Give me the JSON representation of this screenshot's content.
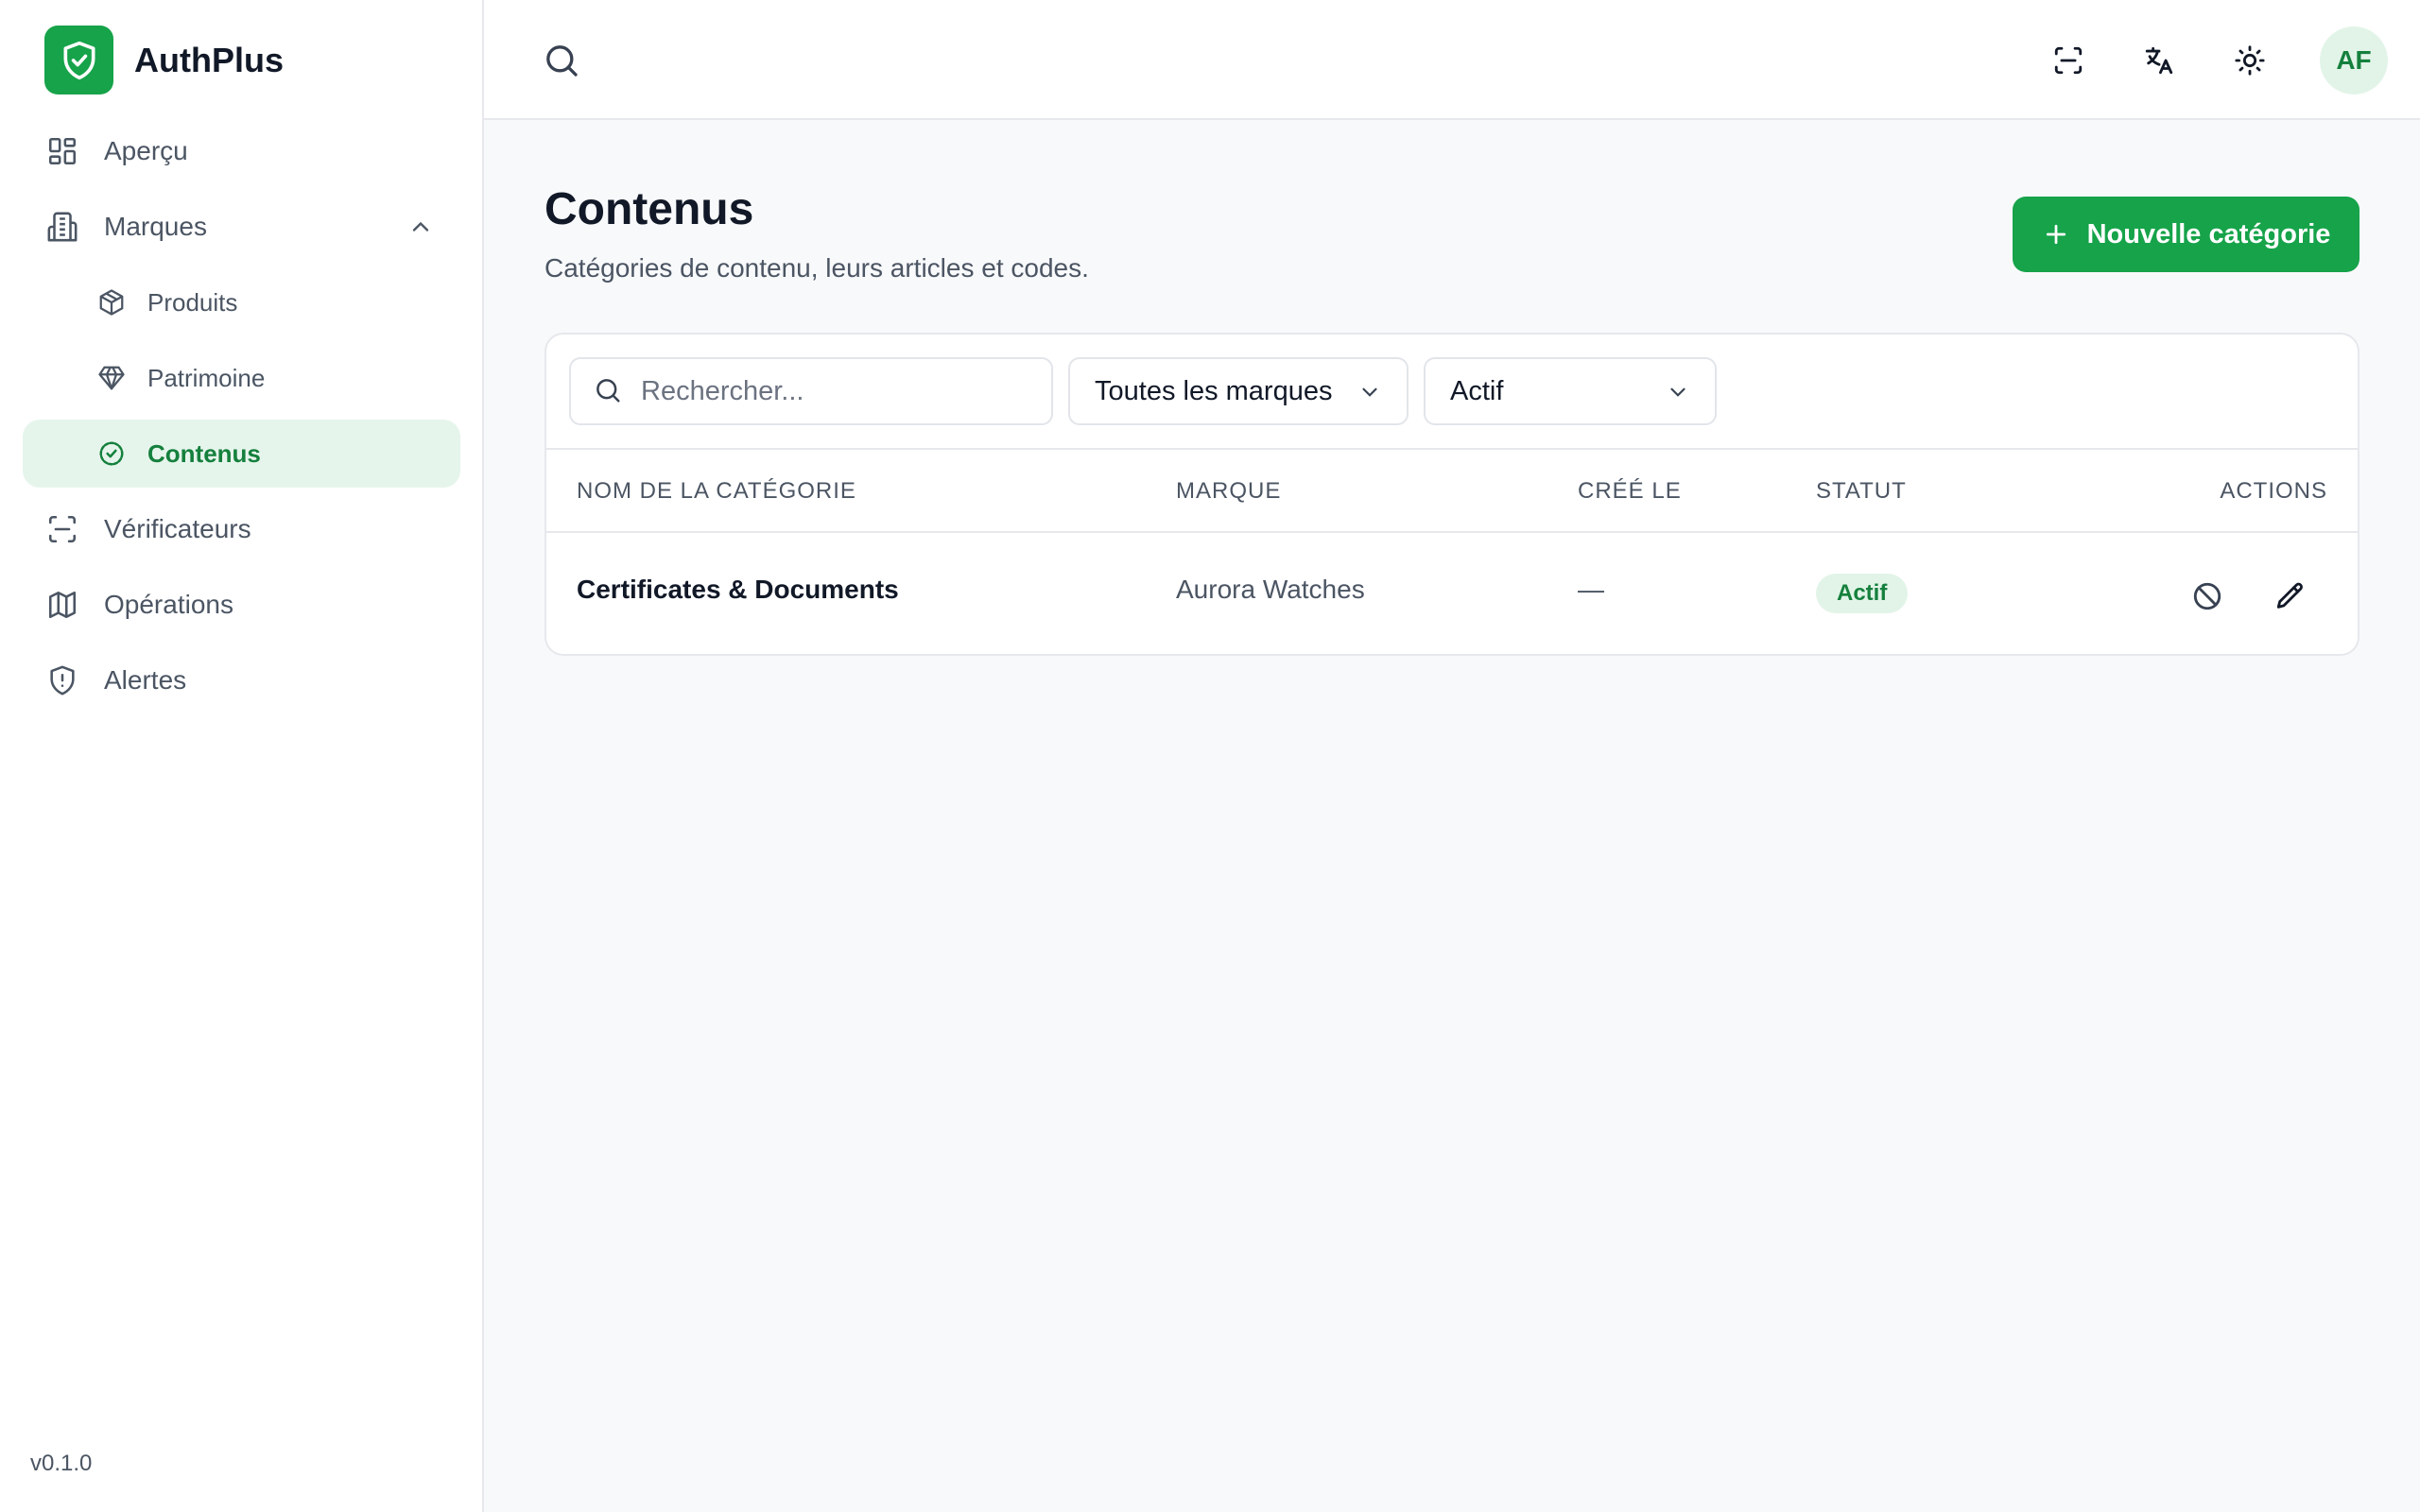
{
  "app": {
    "name": "AuthPlus",
    "version": "v0.1.0"
  },
  "sidebar": {
    "items": [
      {
        "label": "Aperçu",
        "icon": "dashboard-icon"
      },
      {
        "label": "Marques",
        "icon": "building-icon"
      },
      {
        "label": "Produits",
        "icon": "package-icon"
      },
      {
        "label": "Patrimoine",
        "icon": "gem-icon"
      },
      {
        "label": "Contenus",
        "icon": "check-circle-icon"
      },
      {
        "label": "Vérificateurs",
        "icon": "scan-icon"
      },
      {
        "label": "Opérations",
        "icon": "map-icon"
      },
      {
        "label": "Alertes",
        "icon": "shield-alert-icon"
      }
    ],
    "active": "Contenus"
  },
  "topbar": {
    "avatar": "AF",
    "icons": [
      "search-icon",
      "scan-icon",
      "translate-icon",
      "sun-icon"
    ]
  },
  "page": {
    "title": "Contenus",
    "subtitle": "Catégories de contenu, leurs articles et codes.",
    "new_button": "Nouvelle catégorie"
  },
  "filters": {
    "search_placeholder": "Rechercher...",
    "brand_select": "Toutes les marques",
    "status_select": "Actif"
  },
  "table": {
    "columns": [
      "NOM DE LA CATÉGORIE",
      "MARQUE",
      "CRÉÉ LE",
      "STATUT",
      "ACTIONS"
    ],
    "rows": [
      {
        "name": "Certificates & Documents",
        "brand": "Aurora Watches",
        "created": "—",
        "status": "Actif"
      }
    ]
  },
  "colors": {
    "accent": "#16a34a",
    "accent_soft": "#e2f4e8"
  }
}
